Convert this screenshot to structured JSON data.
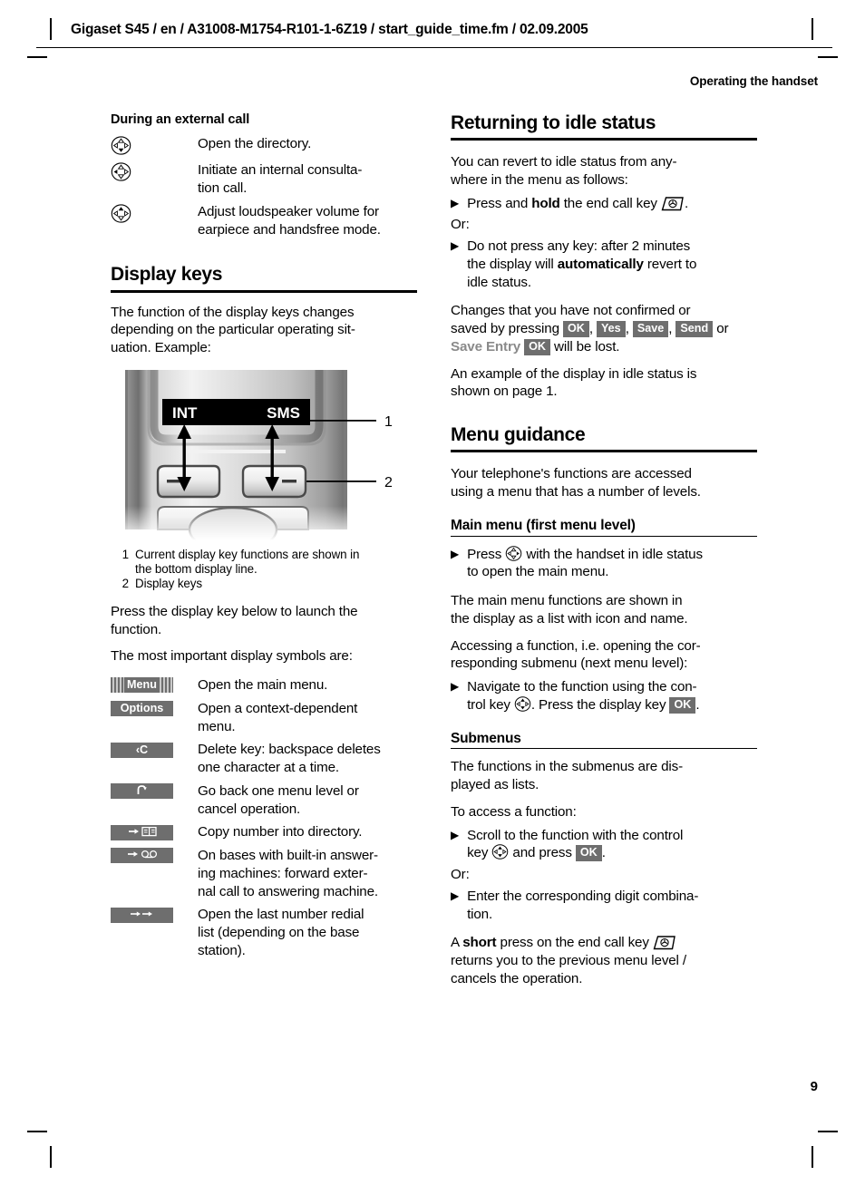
{
  "header": {
    "running_header": "Gigaset S45 / en / A31008-M1754-R101-1-6Z19 / start_guide_time.fm / 02.09.2005",
    "section_title": "Operating the handset"
  },
  "footer": {
    "page_number": "9"
  },
  "left_column": {
    "external_call": {
      "heading": "During an external call",
      "rows": [
        {
          "icon": "control-key-down-icon",
          "text": "Open the directory."
        },
        {
          "icon": "control-key-left-icon",
          "text": "Initiate an internal consulta-tion call."
        },
        {
          "icon": "control-key-up-icon",
          "text": "Adjust loudspeaker volume for earpiece and handsfree mode."
        }
      ]
    },
    "display_keys": {
      "heading": "Display keys",
      "intro": "The function of the display keys changes depending on the particular operating situation. Example:",
      "figure": {
        "display_left_label": "INT",
        "display_right_label": "SMS",
        "callout_1": "1",
        "callout_2": "2"
      },
      "captions": [
        {
          "num": "1",
          "text": "Current display key functions are shown in the bottom display line."
        },
        {
          "num": "2",
          "text": "Display keys"
        }
      ],
      "after_figure": "Press the display key below to launch the function.",
      "symbols_intro": "The most important display symbols are:",
      "symbols": [
        {
          "badge": "Menu",
          "style": "menu-striped",
          "icon": "menu-badge-icon",
          "text": "Open the main menu."
        },
        {
          "badge": "Options",
          "style": "plain",
          "icon": "options-badge-icon",
          "text": "Open a context-dependent menu."
        },
        {
          "badge": "‹C",
          "style": "plain",
          "icon": "backspace-badge-icon",
          "text": "Delete key: backspace deletes one character at a time."
        },
        {
          "badge": "↶",
          "style": "glyph",
          "icon": "back-arrow-badge-icon",
          "text": "Go back one menu level or cancel operation."
        },
        {
          "badge": "",
          "style": "glyph",
          "icon": "copy-to-directory-badge-icon",
          "text": "Copy number into directory."
        },
        {
          "badge": "",
          "style": "glyph",
          "icon": "forward-to-answering-machine-badge-icon",
          "text": "On bases with built-in answering machines: forward external call to answering machine."
        },
        {
          "badge": "",
          "style": "glyph",
          "icon": "last-number-redial-badge-icon",
          "text": "Open the last number redial list (depending on the base station)."
        }
      ]
    }
  },
  "right_column": {
    "idle_status": {
      "heading": "Returning to idle status",
      "intro": "You can revert to idle status from anywhere in the menu as follows:",
      "bullet_1_pre": "Press and ",
      "bullet_1_bold": "hold",
      "bullet_1_post": " the end call key ",
      "bullet_1_end": ".",
      "or_label": "Or:",
      "bullet_2_pre": "Do not press any key: after 2 minutes the display will ",
      "bullet_2_bold": "automatically",
      "bullet_2_post": " revert to idle status.",
      "changes_pre": "Changes that you have not confirmed or saved by pressing ",
      "changes_badges": [
        "OK",
        "Yes",
        "Save",
        "Send"
      ],
      "changes_or": " or ",
      "save_entry_label": "Save Entry",
      "save_entry_badge": "OK",
      "changes_post": " will be lost.",
      "example_text": "An example of the display in idle status is shown on page 1."
    },
    "menu_guidance": {
      "heading": "Menu guidance",
      "intro": "Your telephone's functions are accessed using a menu that has a number of levels.",
      "main_menu": {
        "heading": "Main menu (first menu level)",
        "bullet_pre": "Press ",
        "bullet_post": " with the handset in idle status to open the main menu.",
        "para_1": "The main menu functions are shown in the display as a list with icon and name.",
        "para_2": "Accessing a function, i.e. opening the corresponding submenu (next menu level):",
        "bullet_2_pre": "Navigate to the function using the control key ",
        "bullet_2_mid": ". Press the display key ",
        "bullet_2_badge": "OK",
        "bullet_2_post": "."
      },
      "submenus": {
        "heading": "Submenus",
        "para_1": "The functions in the submenus are displayed as lists.",
        "para_2": "To access a function:",
        "bullet_1_pre": "Scroll to the function with the control key ",
        "bullet_1_mid": " and press ",
        "bullet_1_badge": "OK",
        "bullet_1_post": ".",
        "or_label": "Or:",
        "bullet_2": "Enter the corresponding digit combination.",
        "closing_pre": "A ",
        "closing_bold": "short",
        "closing_mid": " press on the end call key ",
        "closing_post": " returns you to the previous menu level / cancels the operation."
      }
    }
  },
  "colors": {
    "badge_gray": "#6e6e6e",
    "gray_text": "#8a8a8a",
    "display_black": "#000000"
  }
}
